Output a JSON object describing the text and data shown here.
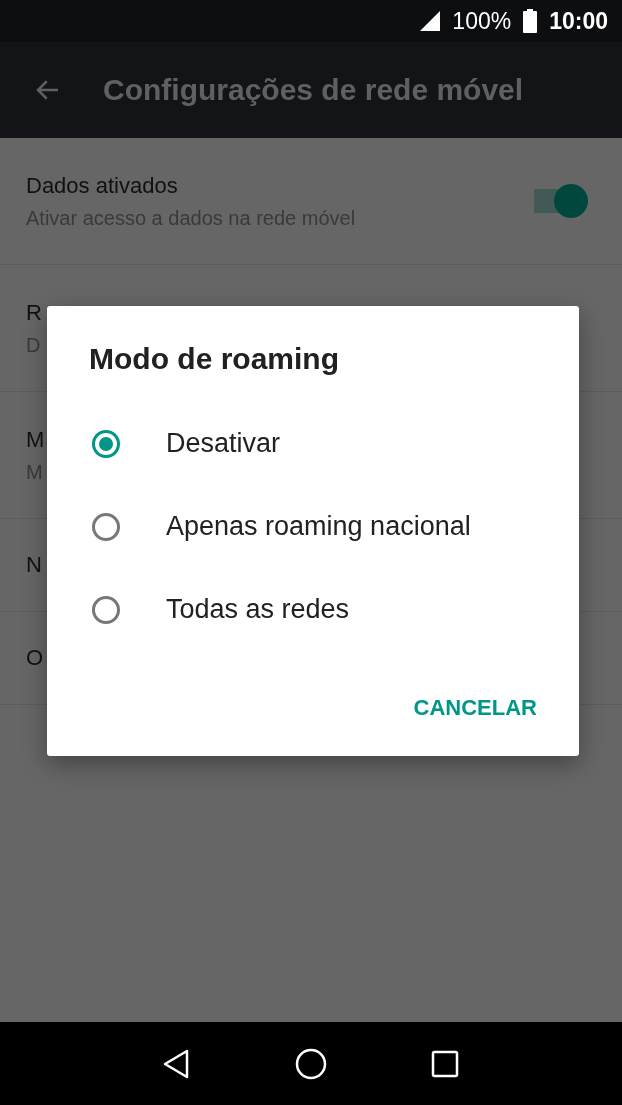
{
  "status_bar": {
    "battery": "100%",
    "time": "10:00"
  },
  "app_bar": {
    "title": "Configurações de rede móvel"
  },
  "settings": [
    {
      "kind": "switch",
      "title": "Dados ativados",
      "subtitle": "Ativar acesso a dados na rede móvel",
      "on": true
    },
    {
      "kind": "plain",
      "title": "R",
      "subtitle": "D"
    },
    {
      "kind": "plain",
      "title": "M",
      "subtitle": "M"
    },
    {
      "kind": "plain",
      "title": "N"
    },
    {
      "kind": "plain",
      "title": "O"
    }
  ],
  "dialog": {
    "title": "Modo de roaming",
    "options": [
      {
        "label": "Desativar",
        "selected": true
      },
      {
        "label": "Apenas roaming nacional",
        "selected": false
      },
      {
        "label": "Todas as redes",
        "selected": false
      }
    ],
    "buttons": [
      "CANCELAR"
    ]
  }
}
